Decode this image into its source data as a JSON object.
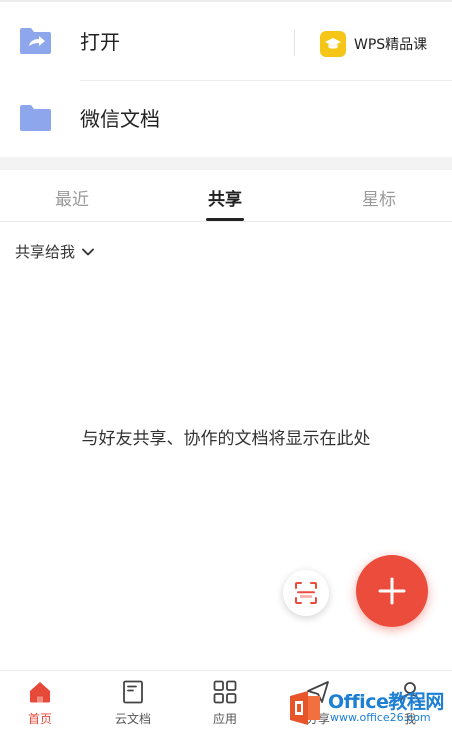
{
  "quick_access": {
    "open_label": "打开",
    "wechat_docs_label": "微信文档",
    "wps_course_label": "WPS精品课"
  },
  "tabs": [
    {
      "label": "最近",
      "active": false
    },
    {
      "label": "共享",
      "active": true
    },
    {
      "label": "星标",
      "active": false
    }
  ],
  "filter": {
    "label": "共享给我"
  },
  "empty_message": "与好友共享、协作的文档将显示在此处",
  "bottom_nav": [
    {
      "label": "首页",
      "icon": "home-icon",
      "active": true
    },
    {
      "label": "云文档",
      "icon": "cloud-doc-icon",
      "active": false
    },
    {
      "label": "应用",
      "icon": "apps-grid-icon",
      "active": false
    },
    {
      "label": "分享",
      "icon": "share-icon",
      "active": false
    },
    {
      "label": "我",
      "icon": "user-icon",
      "active": false
    }
  ],
  "watermark": {
    "brand": "Office教程网",
    "url": "www.office26.com"
  },
  "colors": {
    "accent_red": "#ec4c3c",
    "folder_blue": "#8ea7ec",
    "wps_yellow": "#f5c518",
    "watermark_blue": "#1c7fd3"
  }
}
